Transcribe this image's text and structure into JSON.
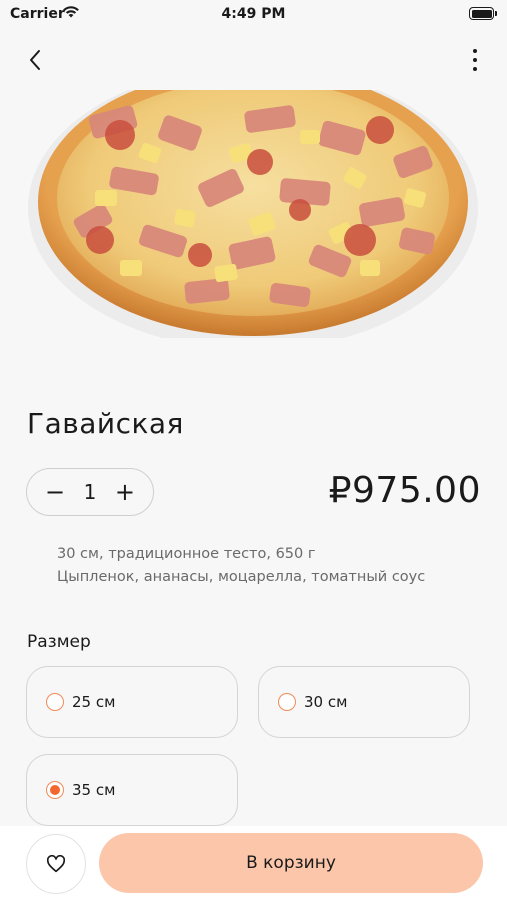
{
  "status_bar": {
    "carrier": "Carrier",
    "time": "4:49 PM"
  },
  "product": {
    "title": "Гавайская",
    "quantity": "1",
    "minus_label": "−",
    "plus_label": "+",
    "price": "₽975.00",
    "desc_line1": "30 см, традиционное тесто, 650 г",
    "desc_line2": "Цыпленок, ананасы, моцарелла, томатный соус"
  },
  "size": {
    "label": "Размер",
    "options": [
      {
        "label": "25 см",
        "selected": false
      },
      {
        "label": "30 см",
        "selected": false
      },
      {
        "label": "35 см",
        "selected": true
      }
    ]
  },
  "actions": {
    "cart_label": "В корзину"
  },
  "colors": {
    "accent": "#f2692f",
    "cart_button": "#fcc6ab"
  }
}
